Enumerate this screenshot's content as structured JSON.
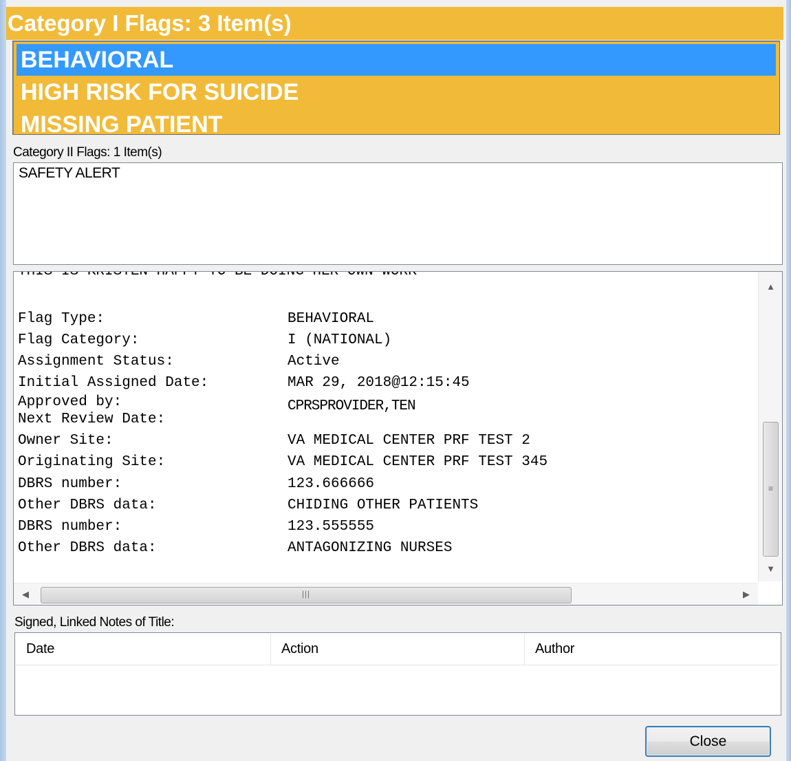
{
  "category1": {
    "header": "Category I Flags: 3 Item(s)",
    "items": [
      "BEHAVIORAL",
      "HIGH RISK FOR SUICIDE",
      "MISSING PATIENT"
    ],
    "selected_index": 0
  },
  "category2": {
    "header": "Category II Flags: 1 Item(s)",
    "items": [
      "SAFETY ALERT"
    ]
  },
  "details": {
    "partial_line": "THIS IS KRISTEN HAPPY TO BE DOING HER OWN WORK",
    "rows": [
      {
        "label": "Flag Type:",
        "value": "BEHAVIORAL"
      },
      {
        "label": "Flag Category:",
        "value": "I (NATIONAL)"
      },
      {
        "label": "Assignment Status:",
        "value": "Active"
      },
      {
        "label": "Initial Assigned Date:",
        "value": "MAR 29, 2018@12:15:45"
      },
      {
        "label": "Approved by:",
        "value": "CPRSPROVIDER,TEN"
      },
      {
        "label": "Next Review Date:",
        "value": ""
      },
      {
        "label": "Owner Site:",
        "value": "VA MEDICAL CENTER PRF TEST 2"
      },
      {
        "label": "Originating Site:",
        "value": "VA MEDICAL CENTER PRF TEST 345"
      },
      {
        "label": "DBRS number:",
        "value": "123.666666"
      },
      {
        "label": "Other DBRS data:",
        "value": "CHIDING OTHER PATIENTS"
      },
      {
        "label": "DBRS number:",
        "value": "123.555555"
      },
      {
        "label": "Other DBRS data:",
        "value": "ANTAGONIZING NURSES"
      }
    ]
  },
  "notes": {
    "label": "Signed, Linked Notes of Title:",
    "columns": [
      "Date",
      "Action",
      "Author"
    ]
  },
  "buttons": {
    "close": "Close"
  },
  "icons": {
    "scroll_up": "up-arrow-icon",
    "scroll_down": "down-arrow-icon",
    "scroll_left": "left-arrow-icon",
    "scroll_right": "right-arrow-icon"
  },
  "colors": {
    "category1_bg": "#f1bb39",
    "selection": "#3399ff",
    "button_border": "#3c7fb1"
  }
}
